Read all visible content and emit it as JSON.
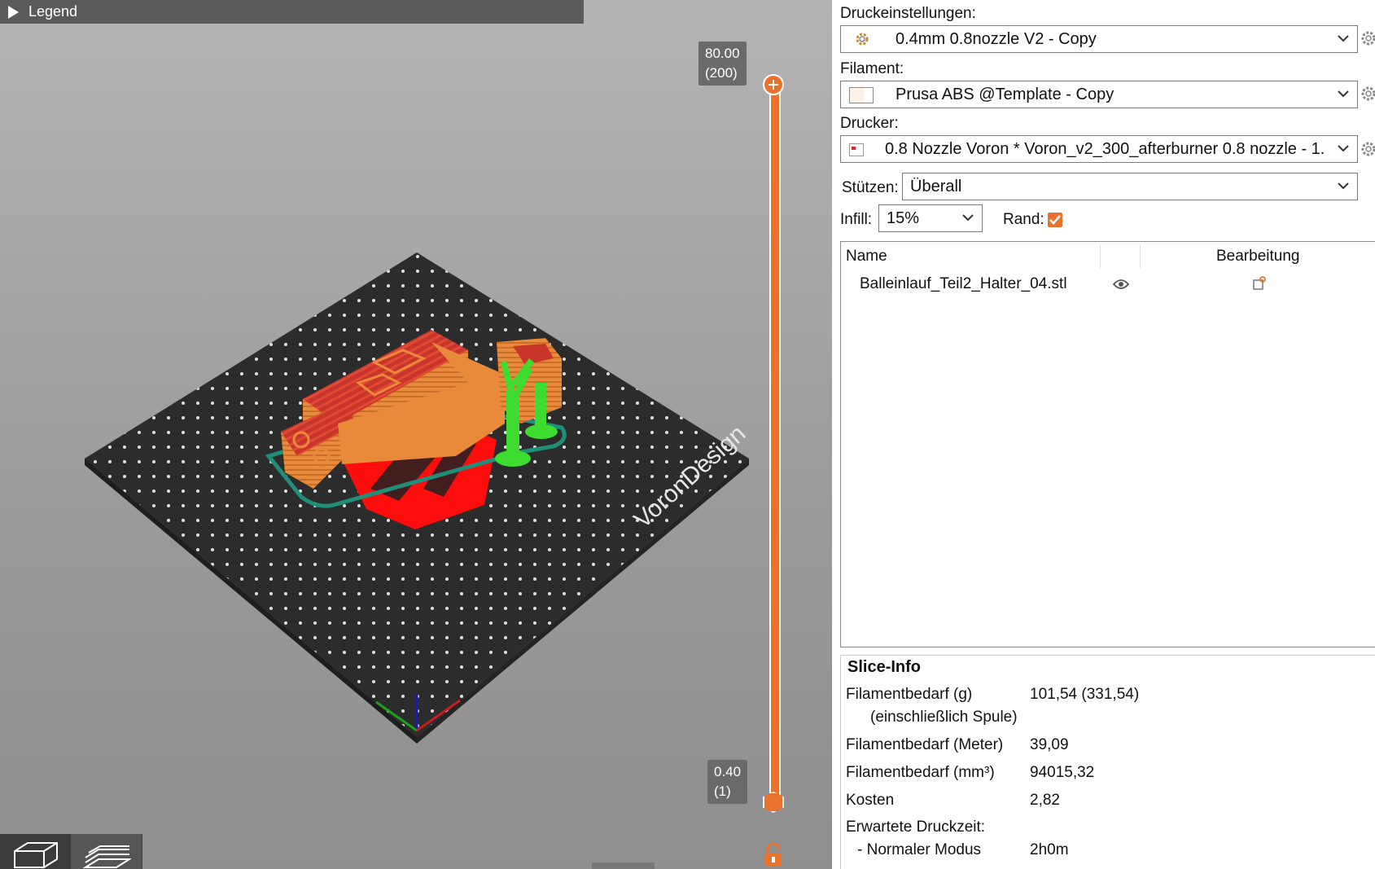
{
  "legend": {
    "label": "Legend"
  },
  "bed": {
    "brand_text": "VoronDesign"
  },
  "slider": {
    "top_height": "80.00",
    "top_layer": "(200)",
    "bottom_height": "0.40",
    "bottom_layer": "(1)"
  },
  "print_settings": {
    "label": "Druckeinstellungen:",
    "value": "0.4mm 0.8nozzle V2 - Copy"
  },
  "filament": {
    "label": "Filament:",
    "value": "Prusa ABS @Template - Copy"
  },
  "printer": {
    "label": "Drucker:",
    "value": "0.8 Nozzle Voron  * Voron_v2_300_afterburner 0.8 nozzle - 1. ..."
  },
  "supports": {
    "label": "Stützen:",
    "value": "Überall"
  },
  "infill": {
    "label": "Infill:",
    "value": "15%"
  },
  "brim": {
    "label": "Rand:",
    "checked": true
  },
  "objects": {
    "col_name": "Name",
    "col_edit": "Bearbeitung",
    "rows": [
      {
        "name": "Balleinlauf_Teil2_Halter_04.stl"
      }
    ]
  },
  "slice_info": {
    "title": "Slice-Info",
    "rows": [
      {
        "key": "Filamentbedarf (g)",
        "value": "101,54 (331,54)"
      },
      {
        "key": "(einschließlich Spule)",
        "value": ""
      },
      {
        "key": "Filamentbedarf (Meter)",
        "value": "39,09"
      },
      {
        "key": "Filamentbedarf (mm³)",
        "value": "94015,32"
      },
      {
        "key": "Kosten",
        "value": "2,82"
      },
      {
        "key": "Erwartete Druckzeit:",
        "value": ""
      },
      {
        "key": "- Normaler Modus",
        "value": "2h0m"
      }
    ]
  },
  "colors": {
    "accent": "#e9722d",
    "part": "#e88a3a",
    "part_top": "#c9342b",
    "support": "#3ddc2f",
    "skirt": "#1f8f7a",
    "logo": "#ff0d0d",
    "bed": "#333333"
  }
}
